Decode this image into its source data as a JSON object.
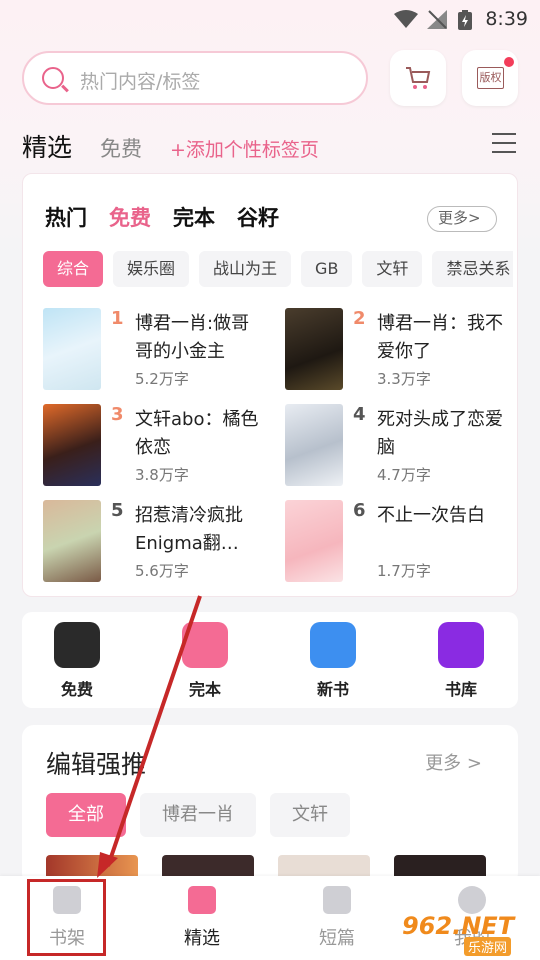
{
  "status_bar": {
    "time": "8:39"
  },
  "search": {
    "placeholder": "热门内容/标签"
  },
  "header_icons": {
    "copyright_label": "版权"
  },
  "tabs": {
    "selected": "精选",
    "free": "免费",
    "add": "+添加个性标签页"
  },
  "hot": {
    "tabs": [
      "热门",
      "免费",
      "完本",
      "谷籽"
    ],
    "active_tab": "免费",
    "more": "更多>",
    "chips": [
      "综合",
      "娱乐圈",
      "战山为王",
      "GB",
      "文轩",
      "禁忌关系"
    ],
    "books": [
      {
        "rank": "1",
        "title": "博君一肖:做哥哥的小金主",
        "count": "5.2万字"
      },
      {
        "rank": "2",
        "title": "博君一肖：我不爱你了",
        "count": "3.3万字"
      },
      {
        "rank": "3",
        "title": "文轩abo：橘色依恋",
        "count": "3.8万字"
      },
      {
        "rank": "4",
        "title": "死对头成了恋爱脑",
        "count": "4.7万字"
      },
      {
        "rank": "5",
        "title": "招惹清冷疯批Enigma翻…",
        "count": "5.6万字"
      },
      {
        "rank": "6",
        "title": "不止一次告白",
        "count": "1.7万字"
      }
    ]
  },
  "quick": [
    "免费",
    "完本",
    "新书",
    "书库"
  ],
  "editor": {
    "title": "编辑强推",
    "more": "更多 >",
    "pills": [
      "全部",
      "博君一肖",
      "文轩"
    ]
  },
  "bottom_nav": [
    "书架",
    "精选",
    "短篇",
    "我的"
  ],
  "watermark": {
    "main": "962.NET",
    "sub": "乐游网"
  },
  "colors": {
    "accent": "#f46b94",
    "annotation": "#c62828"
  }
}
